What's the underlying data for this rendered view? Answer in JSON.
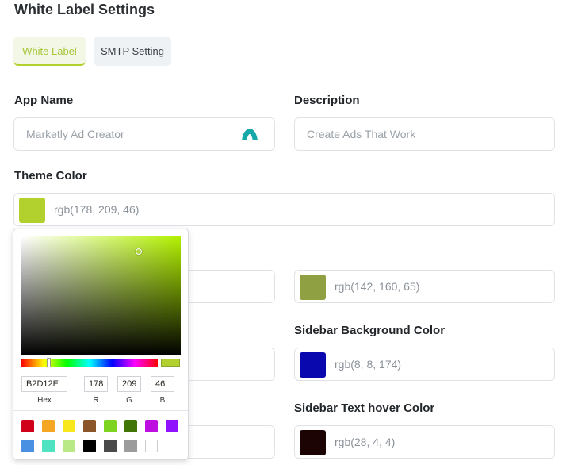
{
  "page": {
    "title": "White Label Settings"
  },
  "tabs": [
    {
      "label": "White Label",
      "active": true
    },
    {
      "label": "SMTP Setting",
      "active": false
    }
  ],
  "form": {
    "app_name": {
      "label": "App Name",
      "placeholder": "Marketly Ad Creator",
      "icon": "app-logo-icon",
      "icon_color": "#14a8a8"
    },
    "description": {
      "label": "Description",
      "placeholder": "Create Ads That Work"
    },
    "theme_color": {
      "label": "Theme Color",
      "value": "rgb(178, 209, 46)",
      "swatch": "#b2d12e"
    },
    "right_color_1": {
      "value": "rgb(142, 160, 65)",
      "swatch": "#8ea041"
    },
    "sidebar_bg": {
      "label": "Sidebar Background Color",
      "value": "rgb(8, 8, 174)",
      "swatch": "#0808ae"
    },
    "sidebar_hover": {
      "label": "Sidebar Text hover Color",
      "value": "rgb(28, 4, 4)",
      "swatch": "#1c0404"
    }
  },
  "picker": {
    "hex": "B2D12E",
    "r": "178",
    "g": "209",
    "b": "46",
    "hex_label": "Hex",
    "r_label": "R",
    "g_label": "G",
    "b_label": "B",
    "presets": [
      "#d0021b",
      "#f5a623",
      "#f8e71c",
      "#8b572a",
      "#7ed321",
      "#417505",
      "#bd10e0",
      "#9013fe",
      "#4a90e2",
      "#50e3c2",
      "#b8e986",
      "#000000",
      "#4a4a4a",
      "#9b9b9b",
      "#ffffff"
    ]
  }
}
